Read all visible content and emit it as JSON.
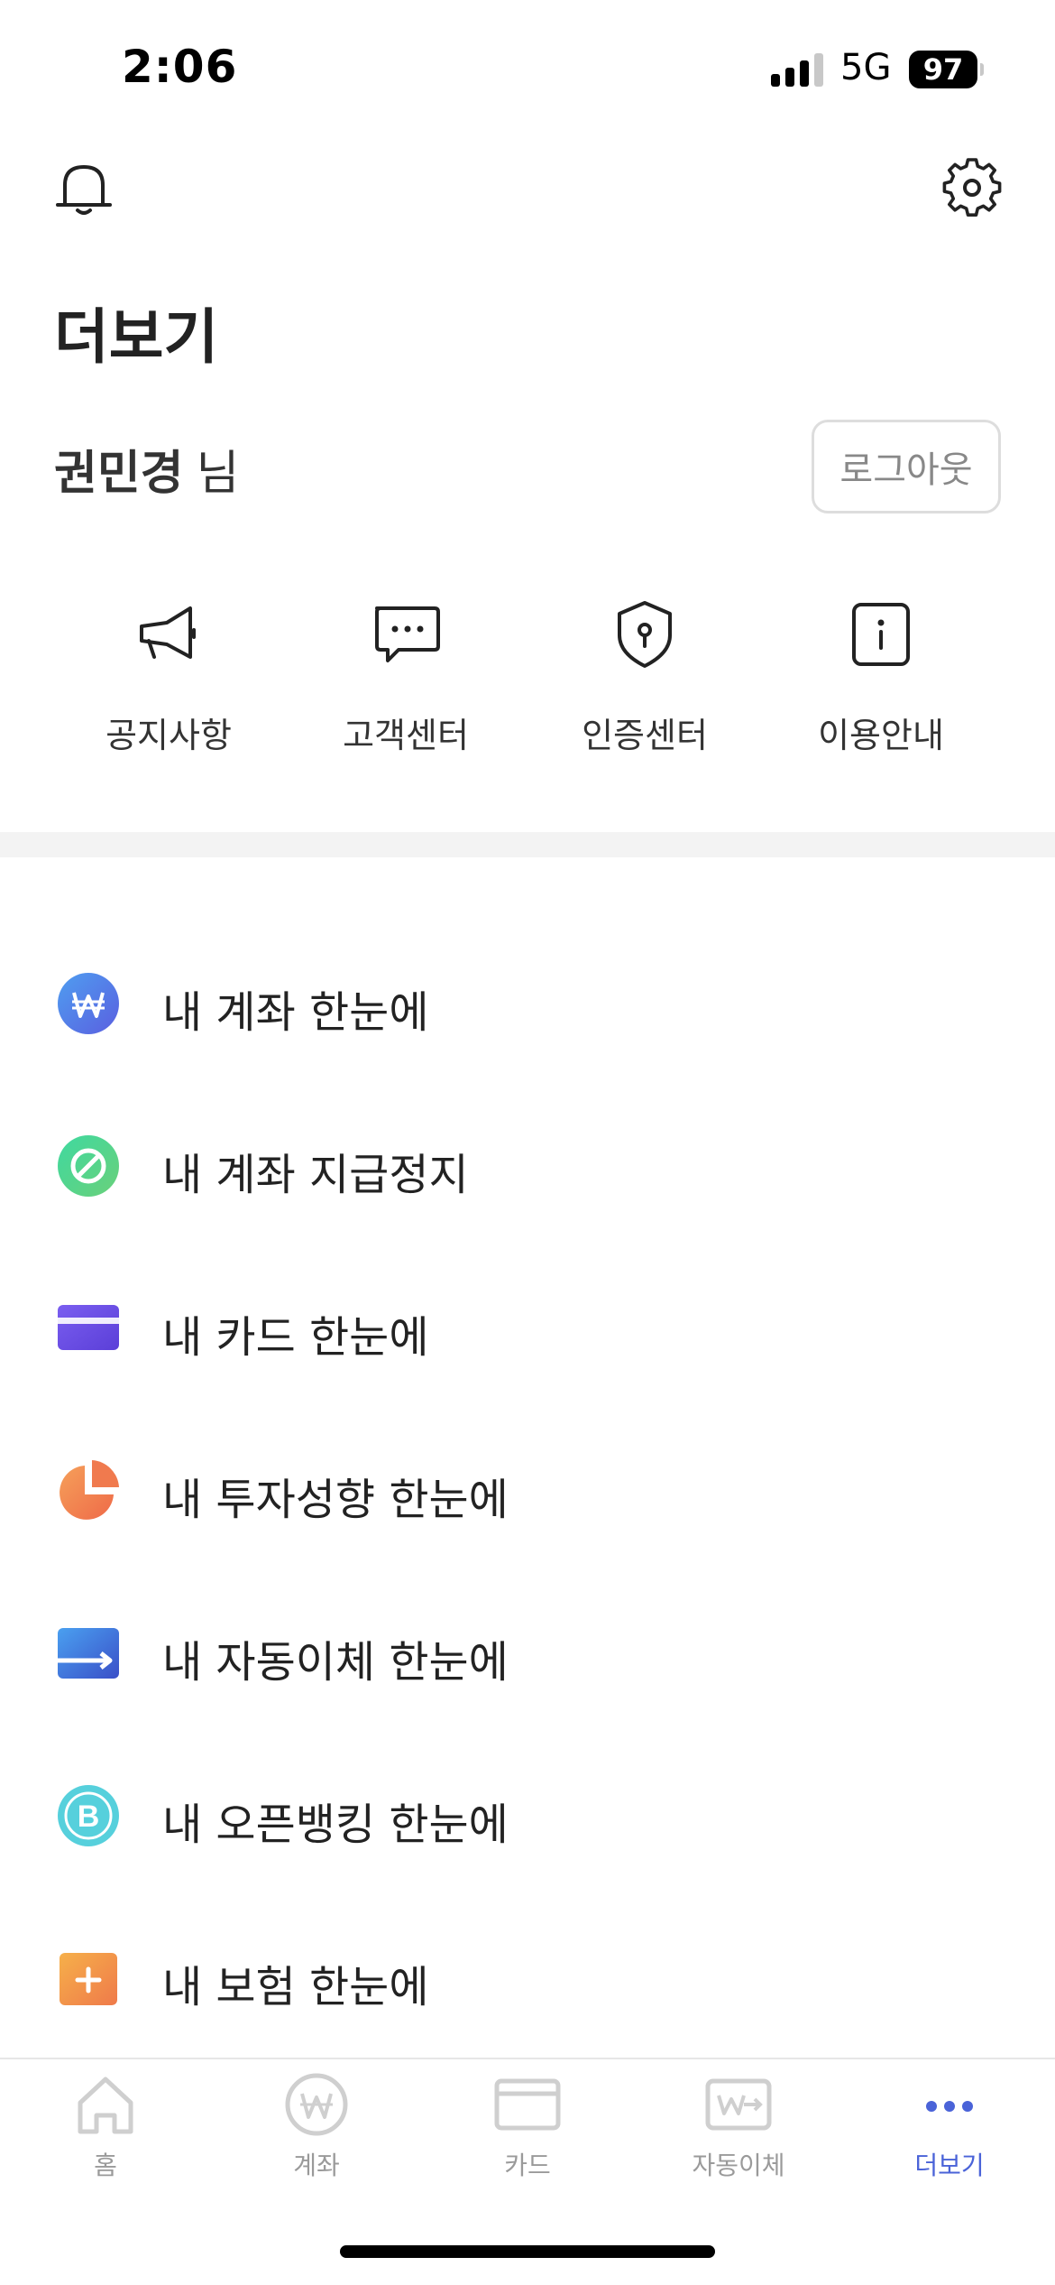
{
  "status_bar": {
    "time": "2:06",
    "network": "5G",
    "battery": "97"
  },
  "header": {
    "title": "더보기",
    "user_name": "권민경",
    "user_suffix": "님",
    "logout_label": "로그아웃"
  },
  "quick_menu": [
    {
      "label": "공지사항",
      "icon": "megaphone-icon"
    },
    {
      "label": "고객센터",
      "icon": "chat-bubble-icon"
    },
    {
      "label": "인증센터",
      "icon": "shield-key-icon"
    },
    {
      "label": "이용안내",
      "icon": "info-icon"
    }
  ],
  "menu_items": [
    {
      "label": "내 계좌 한눈에",
      "icon": "won-coin-icon",
      "color": "#5b7fe8"
    },
    {
      "label": "내 계좌 지급정지",
      "icon": "prohibited-icon",
      "color": "#4fd08a"
    },
    {
      "label": "내 카드 한눈에",
      "icon": "card-icon",
      "color": "#6a4fe0"
    },
    {
      "label": "내 투자성향 한눈에",
      "icon": "pie-chart-icon",
      "color": "#f07a4e"
    },
    {
      "label": "내 자동이체 한눈에",
      "icon": "transfer-arrow-icon",
      "color": "#4a7be0"
    },
    {
      "label": "내 오픈뱅킹 한눈에",
      "icon": "bitcoin-exchange-icon",
      "color": "#4cc9d9"
    },
    {
      "label": "내 보험 한눈에",
      "icon": "insurance-plus-icon",
      "color": "#f09a4a"
    }
  ],
  "tab_bar": [
    {
      "label": "홈",
      "icon": "home-icon",
      "active": false
    },
    {
      "label": "계좌",
      "icon": "won-circle-icon",
      "active": false
    },
    {
      "label": "카드",
      "icon": "card-outline-icon",
      "active": false
    },
    {
      "label": "자동이체",
      "icon": "auto-transfer-icon",
      "active": false
    },
    {
      "label": "더보기",
      "icon": "more-dots-icon",
      "active": true
    }
  ],
  "colors": {
    "accent": "#4a63d8",
    "divider": "#f3f3f3",
    "inactive_tab": "#9a9a9a"
  }
}
